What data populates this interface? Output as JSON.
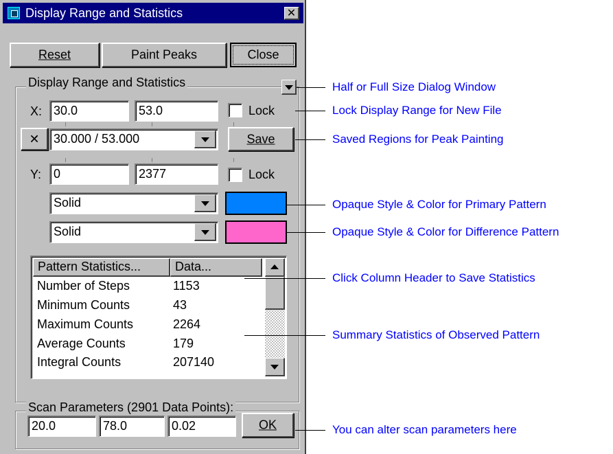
{
  "window": {
    "title": "Display Range and Statistics",
    "close_glyph": "✕"
  },
  "toolbar": {
    "reset": "Reset",
    "paint_peaks": "Paint Peaks",
    "close": "Close"
  },
  "display_group": {
    "label": "Display Range and Statistics",
    "x_label": "X:",
    "x_min": "30.0",
    "x_max": "53.0",
    "lock_label": "Lock",
    "clear_glyph": "✕",
    "region_value": "30.000 / 53.000",
    "save_label": "Save",
    "y_label": "Y:",
    "y_min": "0",
    "y_max": "2377",
    "y_lock_label": "Lock",
    "primary_style": "Solid",
    "difference_style": "Solid",
    "primary_color": "#0080ff",
    "difference_color": "#ff66cc"
  },
  "stats": {
    "headers": [
      "Pattern Statistics...",
      "Data..."
    ],
    "rows": [
      {
        "name": "Number of Steps",
        "value": "1153"
      },
      {
        "name": "Minimum Counts",
        "value": "43"
      },
      {
        "name": "Maximum Counts",
        "value": "2264"
      },
      {
        "name": "Average Counts",
        "value": "179"
      },
      {
        "name": "Integral Counts",
        "value": "207140"
      }
    ]
  },
  "scan_group": {
    "label": "Scan Parameters (2901 Data Points):",
    "start": "20.0",
    "end": "78.0",
    "step": "0.02",
    "ok_label": "OK"
  },
  "annotations": [
    "Half or Full Size Dialog Window",
    "Lock Display Range for New File",
    "Saved Regions for Peak Painting",
    "Opaque Style & Color for Primary Pattern",
    "Opaque Style & Color for Difference Pattern",
    "Click Column Header to Save Statistics",
    "Summary Statistics of Observed Pattern",
    "You can alter scan parameters here"
  ]
}
